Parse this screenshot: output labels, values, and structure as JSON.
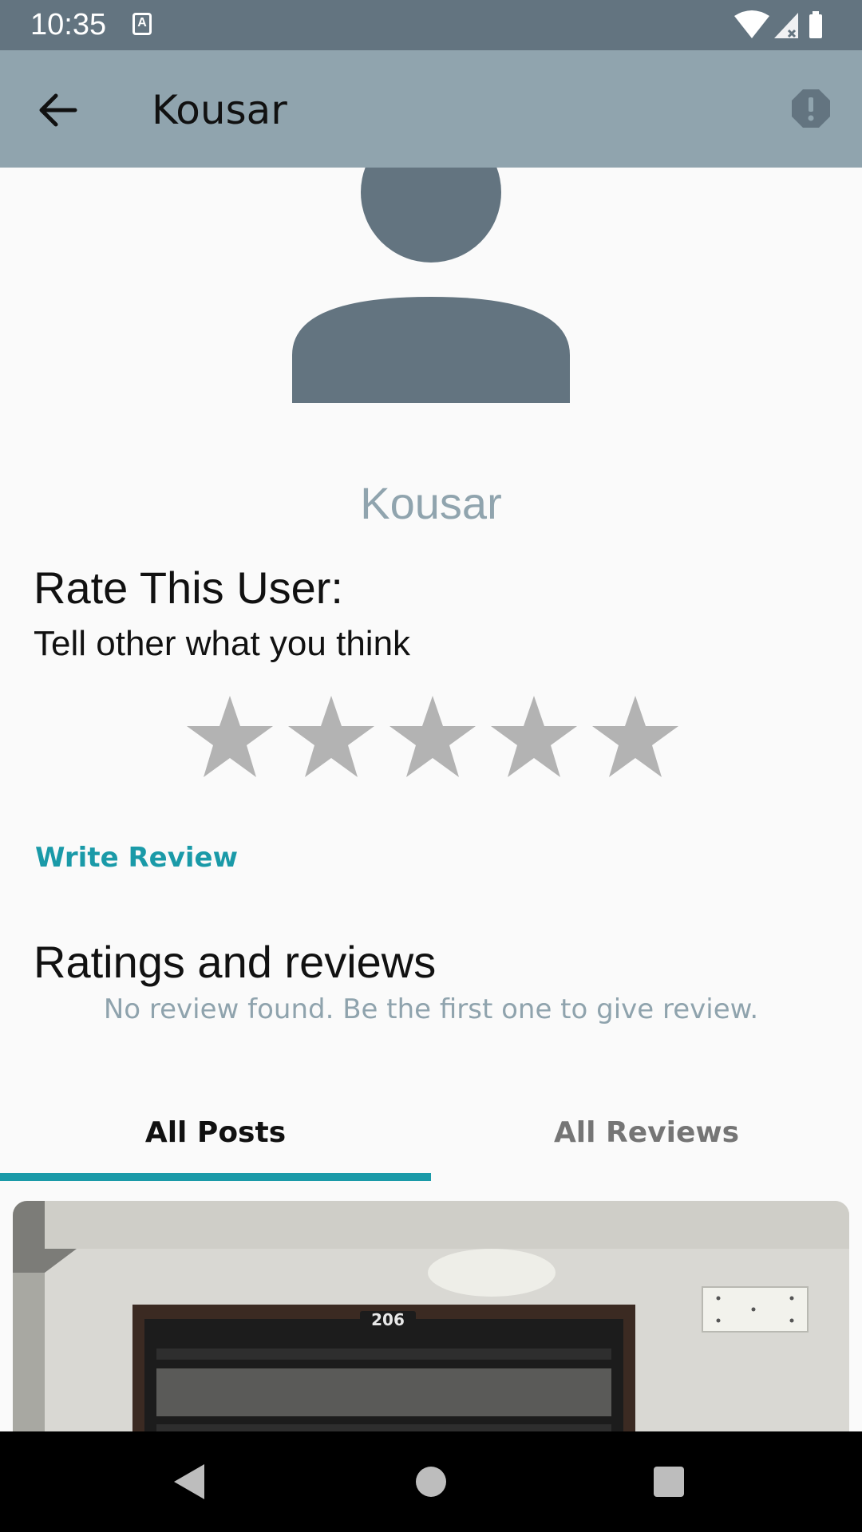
{
  "status_bar": {
    "time": "10:35",
    "notification_icon_letter": "A"
  },
  "app_bar": {
    "title": "Kousar"
  },
  "profile": {
    "name": "Kousar"
  },
  "rating": {
    "heading": "Rate This User:",
    "subtitle": "Tell other what you think",
    "stars_total": 5,
    "stars_selected": 0
  },
  "actions": {
    "write_review": "Write Review"
  },
  "reviews": {
    "heading": "Ratings and reviews",
    "empty_message": "No review found. Be the first one to give review."
  },
  "tabs": [
    {
      "label": "All Posts",
      "selected": true
    },
    {
      "label": "All Reviews",
      "selected": false
    }
  ],
  "post_image": {
    "door_number": "206"
  },
  "colors": {
    "status_bar": "#637480",
    "app_bar": "#90a4ae",
    "accent": "#1a9aa8",
    "star_empty": "#b3b3b3"
  }
}
